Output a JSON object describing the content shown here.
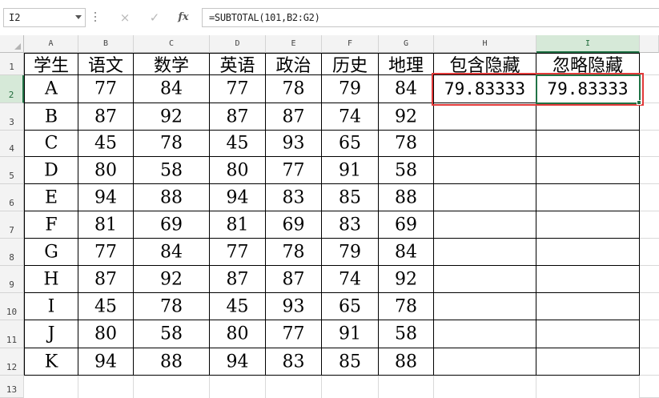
{
  "formula_bar": {
    "name_box": "I2",
    "fx_label": "fx",
    "formula": "=SUBTOTAL(101,B2:G2)",
    "cancel_icon": "×",
    "enter_icon": "✓"
  },
  "columns": [
    "A",
    "B",
    "C",
    "D",
    "E",
    "F",
    "G",
    "H",
    "I"
  ],
  "rows": [
    "1",
    "2",
    "3",
    "4",
    "5",
    "6",
    "7",
    "8",
    "9",
    "10",
    "11",
    "12",
    "13"
  ],
  "headers": [
    "学生",
    "语文",
    "数学",
    "英语",
    "政治",
    "历史",
    "地理",
    "包含隐藏",
    "忽略隐藏"
  ],
  "data": [
    [
      "A",
      "77",
      "84",
      "77",
      "78",
      "79",
      "84",
      "79.83333",
      "79.83333"
    ],
    [
      "B",
      "87",
      "92",
      "87",
      "87",
      "74",
      "92",
      "",
      ""
    ],
    [
      "C",
      "45",
      "78",
      "45",
      "93",
      "65",
      "78",
      "",
      ""
    ],
    [
      "D",
      "80",
      "58",
      "80",
      "77",
      "91",
      "58",
      "",
      ""
    ],
    [
      "E",
      "94",
      "88",
      "94",
      "83",
      "85",
      "88",
      "",
      ""
    ],
    [
      "F",
      "81",
      "69",
      "81",
      "69",
      "83",
      "69",
      "",
      ""
    ],
    [
      "G",
      "77",
      "84",
      "77",
      "78",
      "79",
      "84",
      "",
      ""
    ],
    [
      "H",
      "87",
      "92",
      "87",
      "87",
      "74",
      "92",
      "",
      ""
    ],
    [
      "I",
      "45",
      "78",
      "45",
      "93",
      "65",
      "78",
      "",
      ""
    ],
    [
      "J",
      "80",
      "58",
      "80",
      "77",
      "91",
      "58",
      "",
      ""
    ],
    [
      "K",
      "94",
      "88",
      "94",
      "83",
      "85",
      "88",
      "",
      ""
    ]
  ],
  "active_cell": "I2",
  "colors": {
    "accent": "#217346",
    "highlight_box": "#e23a3a",
    "header_bg": "#f3f3f3"
  }
}
